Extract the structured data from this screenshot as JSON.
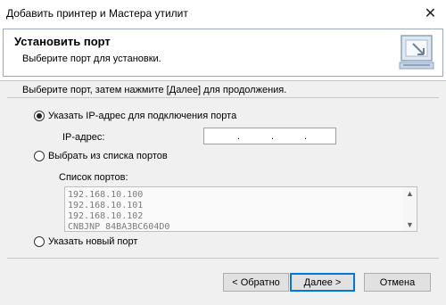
{
  "window": {
    "title": "Добавить принтер и Мастера утилит",
    "close_glyph": "✕"
  },
  "header": {
    "title": "Установить порт",
    "subtitle": "Выберите порт для установки."
  },
  "instruction": "Выберите порт, затем нажмите [Далее] для продолжения.",
  "options": {
    "ip": {
      "label": "Указать IP-адрес для подключения порта",
      "selected": true
    },
    "ip_field": {
      "label": "IP-адрес:",
      "value": ". . ."
    },
    "list": {
      "label": "Выбрать из списка портов",
      "selected": false
    },
    "new": {
      "label": "Указать новый порт",
      "selected": false
    }
  },
  "ports": {
    "label": "Список портов:",
    "items": [
      "192.168.10.100",
      "192.168.10.101",
      "192.168.10.102",
      "CNBJNP_84BA3BC604D0"
    ]
  },
  "buttons": {
    "back": "< Обратно",
    "next": "Далее >",
    "cancel": "Отмена"
  },
  "icons": {
    "header_icon": "printer-port-icon",
    "close": "close-icon"
  }
}
